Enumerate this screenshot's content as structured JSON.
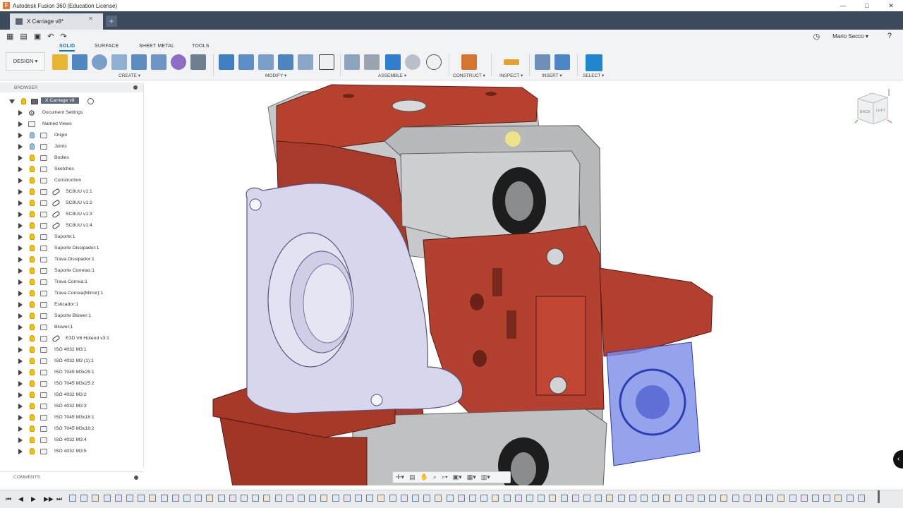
{
  "titlebar": {
    "title": "Autodesk Fusion 360 (Education License)",
    "logo": "F",
    "minimize": "—",
    "restore": "□",
    "close": "✕"
  },
  "doc_tab": {
    "label": "X Carriage v8*",
    "close": "✕",
    "new_tab": "+"
  },
  "qat": {
    "grid_icon": "▦",
    "file_icon": "▤",
    "save_icon": "▣",
    "undo_icon": "↶",
    "redo_icon": "↷",
    "clock_icon": "◷",
    "user": "Mario Secco ▾",
    "help_icon": "?"
  },
  "ribbon": {
    "workspace": "DESIGN ▾",
    "tabs": [
      "SOLID",
      "SURFACE",
      "SHEET METAL",
      "TOOLS"
    ],
    "groups": [
      "CREATE ▾",
      "MODIFY ▾",
      "ASSEMBLE ▾",
      "CONSTRUCT ▾",
      "INSPECT ▾",
      "INSERT ▾",
      "SELECT ▾"
    ]
  },
  "browser": {
    "title": "BROWSER",
    "root": "X Carriage v8",
    "items": [
      "Document Settings",
      "Named Views",
      "Origin",
      "Joints",
      "Bodies",
      "Sketches",
      "Construction",
      "SC8UU v1:1",
      "SC8UU v1:2",
      "SC8UU v1:3",
      "SC8UU v1:4",
      "Suporte:1",
      "Suporte Dissipador:1",
      "Trava Dissipador:1",
      "Suporte Correias:1",
      "Trava Correia:1",
      "Trava Correia(Mirror):1",
      "Esticador:1",
      "Suporte Blower:1",
      "Blower:1",
      "E3D V6 Hotend v3:1",
      "ISO 4032 M3:1",
      "ISO 4032 M3 (1):1",
      "ISO 7045 M3x25:1",
      "ISO 7045 M3x25:2",
      "ISO 4032 M3:2",
      "ISO 4032 M3:3",
      "ISO 7045 M3x18:1",
      "ISO 7045 M3x18:2",
      "ISO 4032 M3:4",
      "ISO 4032 M3:5"
    ]
  },
  "comments": {
    "title": "COMMENTS"
  },
  "viewcube": {
    "back": "BACK",
    "left": "LEFT"
  },
  "navbar": {
    "icons": [
      "✛▾",
      "▤",
      "✋",
      "⌕",
      "⌕▾",
      "▣▾",
      "▦▾",
      "▥▾"
    ]
  },
  "timeline": {
    "controls": [
      "⏮",
      "◀",
      "▶",
      "▶▶",
      "⏭"
    ]
  },
  "colors": {
    "part_red": "#b7412f",
    "part_gray": "#c9cbcc",
    "fan_lilac": "#d9d8ee",
    "fan_blue": "#6a7ee0",
    "accent": "#0a72c7"
  }
}
